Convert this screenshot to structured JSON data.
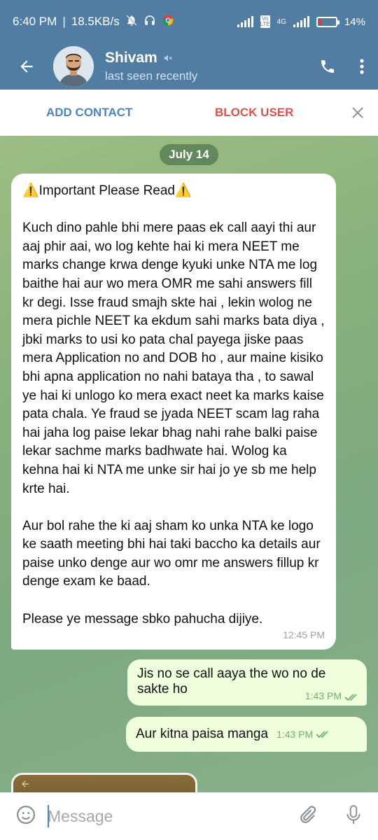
{
  "status_bar": {
    "time": "6:40 PM",
    "separator": "|",
    "net_speed": "18.5KB/s",
    "network_badge": "Vo LTE",
    "network_type": "4G",
    "battery": "14%",
    "battery_color": "#e53935"
  },
  "header": {
    "contact_name": "Shivam",
    "last_seen": "last seen recently",
    "muted_icon": "muted-speaker-icon",
    "bg_color": "#527da3"
  },
  "action_bar": {
    "add_contact": "ADD CONTACT",
    "block_user": "BLOCK USER",
    "add_color": "#4a86bd",
    "block_color": "#d9534f"
  },
  "chat": {
    "date_label": "July 14",
    "incoming": {
      "title": "⚠️Important Please Read⚠️",
      "paragraph1": "Kuch dino pahle bhi mere paas ek call aayi thi aur aaj phir aai, wo log kehte hai ki mera NEET me marks change krwa denge kyuki unke NTA me log baithe hai aur wo mera OMR me sahi answers fill kr degi. Isse fraud smajh skte hai , lekin wolog ne mera pichle NEET ka ekdum sahi marks bata diya , jbki marks to usi ko pata chal payega jiske paas mera Application no and DOB ho , aur maine kisiko bhi apna application no nahi bataya tha , to sawal ye hai ki unlogo ko mera exact neet ka marks kaise pata chala. Ye fraud se jyada NEET scam lag raha hai jaha log paise lekar bhag nahi rahe balki paise lekar sachme marks badhwate hai. Wolog ka kehna hai ki NTA me unke sir hai jo ye sb me help krte hai.",
      "paragraph2": "Aur bol rahe the ki aaj sham ko unka NTA ke logo ke saath meeting bhi hai taki baccho ka details aur paise unko denge aur wo omr me answers fillup kr denge exam ke baad.",
      "paragraph3": "Please ye message sbko pahucha dijiye.",
      "time": "12:45 PM"
    },
    "outgoing": [
      {
        "text": "Jis no se call aaya the wo no de sakte ho",
        "time": "1:43 PM",
        "status": "read"
      },
      {
        "text": "Aur kitna paisa manga",
        "time": "1:43 PM",
        "status": "read"
      }
    ]
  },
  "input_bar": {
    "placeholder": "Message"
  }
}
